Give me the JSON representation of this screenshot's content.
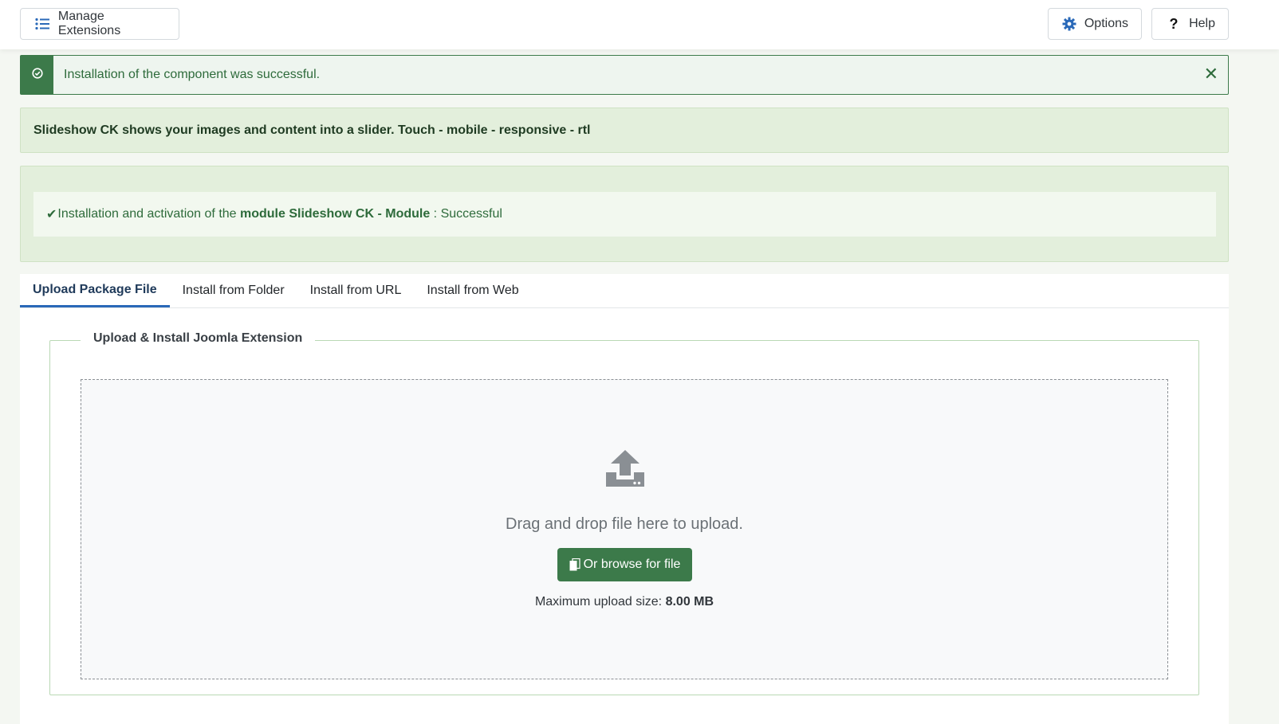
{
  "toolbar": {
    "manage_label": "Manage Extensions",
    "options_label": "Options",
    "help_label": "Help"
  },
  "alert": {
    "message": "Installation of the component was successful.",
    "close_glyph": "✕",
    "accent": "#3c7a4a"
  },
  "info": {
    "description": "Slideshow CK shows your images and content into a slider. Touch - mobile - responsive - rtl"
  },
  "install_result": {
    "check_glyph": "✔",
    "prefix": "Installation and activation of the ",
    "module_name": "module Slideshow CK - Module",
    "suffix": " : Successful"
  },
  "tabs": [
    {
      "label": "Upload Package File",
      "active": true
    },
    {
      "label": "Install from Folder",
      "active": false
    },
    {
      "label": "Install from URL",
      "active": false
    },
    {
      "label": "Install from Web",
      "active": false
    }
  ],
  "upload": {
    "legend": "Upload & Install Joomla Extension",
    "drop_text": "Drag and drop file here to upload.",
    "browse_label": "Or browse for file",
    "max_label": "Maximum upload size: ",
    "max_value": "8.00 MB"
  },
  "icons": {
    "manage": "list-icon",
    "options": "gear-icon",
    "help": "question-icon",
    "alert": "check-circle-icon",
    "upload": "upload-icon",
    "browse": "copy-icon"
  }
}
